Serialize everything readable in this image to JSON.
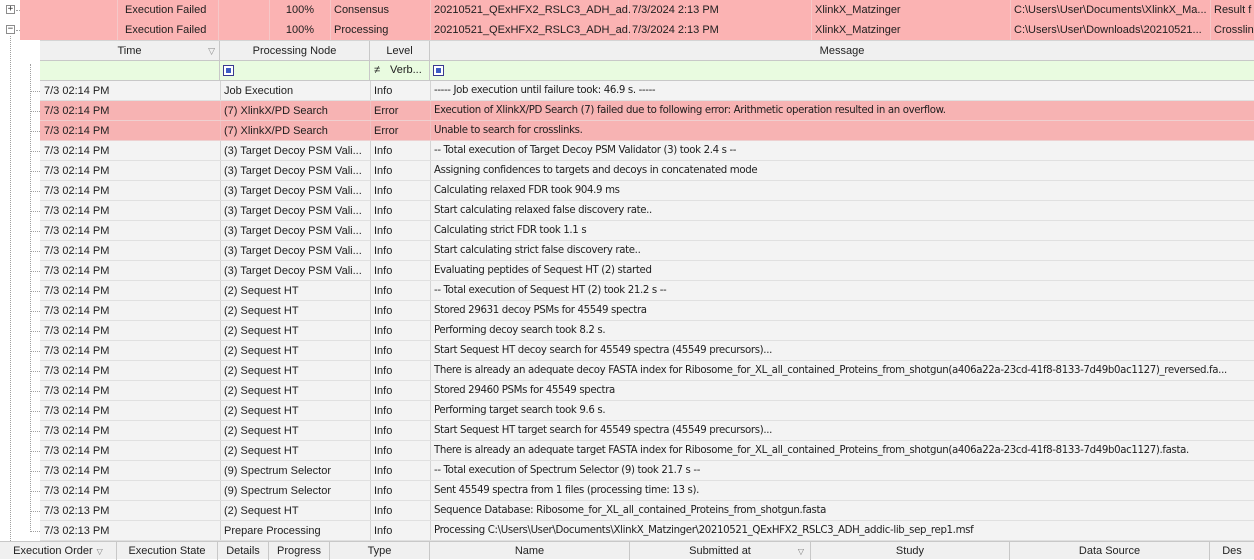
{
  "jobs": [
    {
      "expander": "+",
      "state": "Execution Failed",
      "progress": "100%",
      "type": "Consensus",
      "name": "20210521_QExHFX2_RSLC3_ADH_ad...",
      "submitted": "7/3/2024 2:13 PM",
      "study": "XlinkX_Matzinger",
      "datasource": "C:\\Users\\User\\Documents\\XlinkX_Ma...",
      "extra": "Result f"
    },
    {
      "expander": "−",
      "state": "Execution Failed",
      "progress": "100%",
      "type": "Processing",
      "name": "20210521_QExHFX2_RSLC3_ADH_ad...",
      "submitted": "7/3/2024 2:13 PM",
      "study": "XlinkX_Matzinger",
      "datasource": "C:\\Users\\User\\Downloads\\20210521...",
      "extra": "Crosslin"
    }
  ],
  "log_header": {
    "time": "Time",
    "node": "Processing Node",
    "level": "Level",
    "message": "Message"
  },
  "filter": {
    "level_op": "≠",
    "level_value": "Verb..."
  },
  "log_rows": [
    {
      "time": "7/3 02:14 PM",
      "node": "Job Execution",
      "level": "Info",
      "message": "----- Job execution until failure took: 46.9 s. -----",
      "error": false
    },
    {
      "time": "7/3 02:14 PM",
      "node": "(7) XlinkX/PD Search",
      "level": "Error",
      "message": "Execution of XlinkX/PD Search (7) failed due to following error: Arithmetic operation resulted in an overflow.",
      "error": true
    },
    {
      "time": "7/3 02:14 PM",
      "node": "(7) XlinkX/PD Search",
      "level": "Error",
      "message": "Unable to search for crosslinks.",
      "error": true
    },
    {
      "time": "7/3 02:14 PM",
      "node": "(3) Target Decoy PSM Vali...",
      "level": "Info",
      "message": "-- Total execution of Target Decoy PSM Validator (3) took 2.4 s --",
      "error": false
    },
    {
      "time": "7/3 02:14 PM",
      "node": "(3) Target Decoy PSM Vali...",
      "level": "Info",
      "message": "Assigning confidences to targets and decoys in concatenated mode",
      "error": false
    },
    {
      "time": "7/3 02:14 PM",
      "node": "(3) Target Decoy PSM Vali...",
      "level": "Info",
      "message": "Calculating relaxed FDR took 904.9 ms",
      "error": false
    },
    {
      "time": "7/3 02:14 PM",
      "node": "(3) Target Decoy PSM Vali...",
      "level": "Info",
      "message": "Start calculating relaxed false discovery rate..",
      "error": false
    },
    {
      "time": "7/3 02:14 PM",
      "node": "(3) Target Decoy PSM Vali...",
      "level": "Info",
      "message": "Calculating strict FDR took 1.1 s",
      "error": false
    },
    {
      "time": "7/3 02:14 PM",
      "node": "(3) Target Decoy PSM Vali...",
      "level": "Info",
      "message": "Start calculating strict false discovery rate..",
      "error": false
    },
    {
      "time": "7/3 02:14 PM",
      "node": "(3) Target Decoy PSM Vali...",
      "level": "Info",
      "message": "Evaluating peptides of Sequest HT (2) started",
      "error": false
    },
    {
      "time": "7/3 02:14 PM",
      "node": "(2) Sequest HT",
      "level": "Info",
      "message": "-- Total execution of Sequest HT (2) took 21.2 s --",
      "error": false
    },
    {
      "time": "7/3 02:14 PM",
      "node": "(2) Sequest HT",
      "level": "Info",
      "message": "Stored 29631 decoy PSMs for 45549 spectra",
      "error": false
    },
    {
      "time": "7/3 02:14 PM",
      "node": "(2) Sequest HT",
      "level": "Info",
      "message": "Performing decoy search took 8.2 s.",
      "error": false
    },
    {
      "time": "7/3 02:14 PM",
      "node": "(2) Sequest HT",
      "level": "Info",
      "message": "Start Sequest HT decoy search for 45549 spectra (45549 precursors)...",
      "error": false
    },
    {
      "time": "7/3 02:14 PM",
      "node": "(2) Sequest HT",
      "level": "Info",
      "message": "There is already an adequate decoy FASTA index for Ribosome_for_XL_all_contained_Proteins_from_shotgun(a406a22a-23cd-41f8-8133-7d49b0ac1127)_reversed.fa...",
      "error": false
    },
    {
      "time": "7/3 02:14 PM",
      "node": "(2) Sequest HT",
      "level": "Info",
      "message": "Stored 29460 PSMs for 45549 spectra",
      "error": false
    },
    {
      "time": "7/3 02:14 PM",
      "node": "(2) Sequest HT",
      "level": "Info",
      "message": "Performing target search took 9.6 s.",
      "error": false
    },
    {
      "time": "7/3 02:14 PM",
      "node": "(2) Sequest HT",
      "level": "Info",
      "message": "Start Sequest HT target search for 45549 spectra (45549 precursors)...",
      "error": false
    },
    {
      "time": "7/3 02:14 PM",
      "node": "(2) Sequest HT",
      "level": "Info",
      "message": "There is already an adequate target FASTA index for Ribosome_for_XL_all_contained_Proteins_from_shotgun(a406a22a-23cd-41f8-8133-7d49b0ac1127).fasta.",
      "error": false
    },
    {
      "time": "7/3 02:14 PM",
      "node": "(9) Spectrum Selector",
      "level": "Info",
      "message": "-- Total execution of Spectrum Selector (9) took 21.7 s --",
      "error": false
    },
    {
      "time": "7/3 02:14 PM",
      "node": "(9) Spectrum Selector",
      "level": "Info",
      "message": "Sent 45549 spectra from 1 files (processing time: 13 s).",
      "error": false
    },
    {
      "time": "7/3 02:13 PM",
      "node": "(2) Sequest HT",
      "level": "Info",
      "message": "Sequence Database: Ribosome_for_XL_all_contained_Proteins_from_shotgun.fasta",
      "error": false
    },
    {
      "time": "7/3 02:13 PM",
      "node": "Prepare Processing",
      "level": "Info",
      "message": "Processing C:\\Users\\User\\Documents\\XlinkX_Matzinger\\20210521_QExHFX2_RSLC3_ADH_addic-lib_sep_rep1.msf",
      "error": false
    }
  ],
  "bottom_header": {
    "execution_order": "Execution Order",
    "execution_state": "Execution State",
    "details": "Details",
    "progress": "Progress",
    "type": "Type",
    "name": "Name",
    "submitted_at": "Submitted at",
    "study": "Study",
    "data_source": "Data Source",
    "description": "Des"
  },
  "colors": {
    "error_row": "#f7b3b3",
    "job_row": "#fbb3b3",
    "filter_row": "#e9fbe0",
    "header_bg": "#f0f0f0"
  }
}
